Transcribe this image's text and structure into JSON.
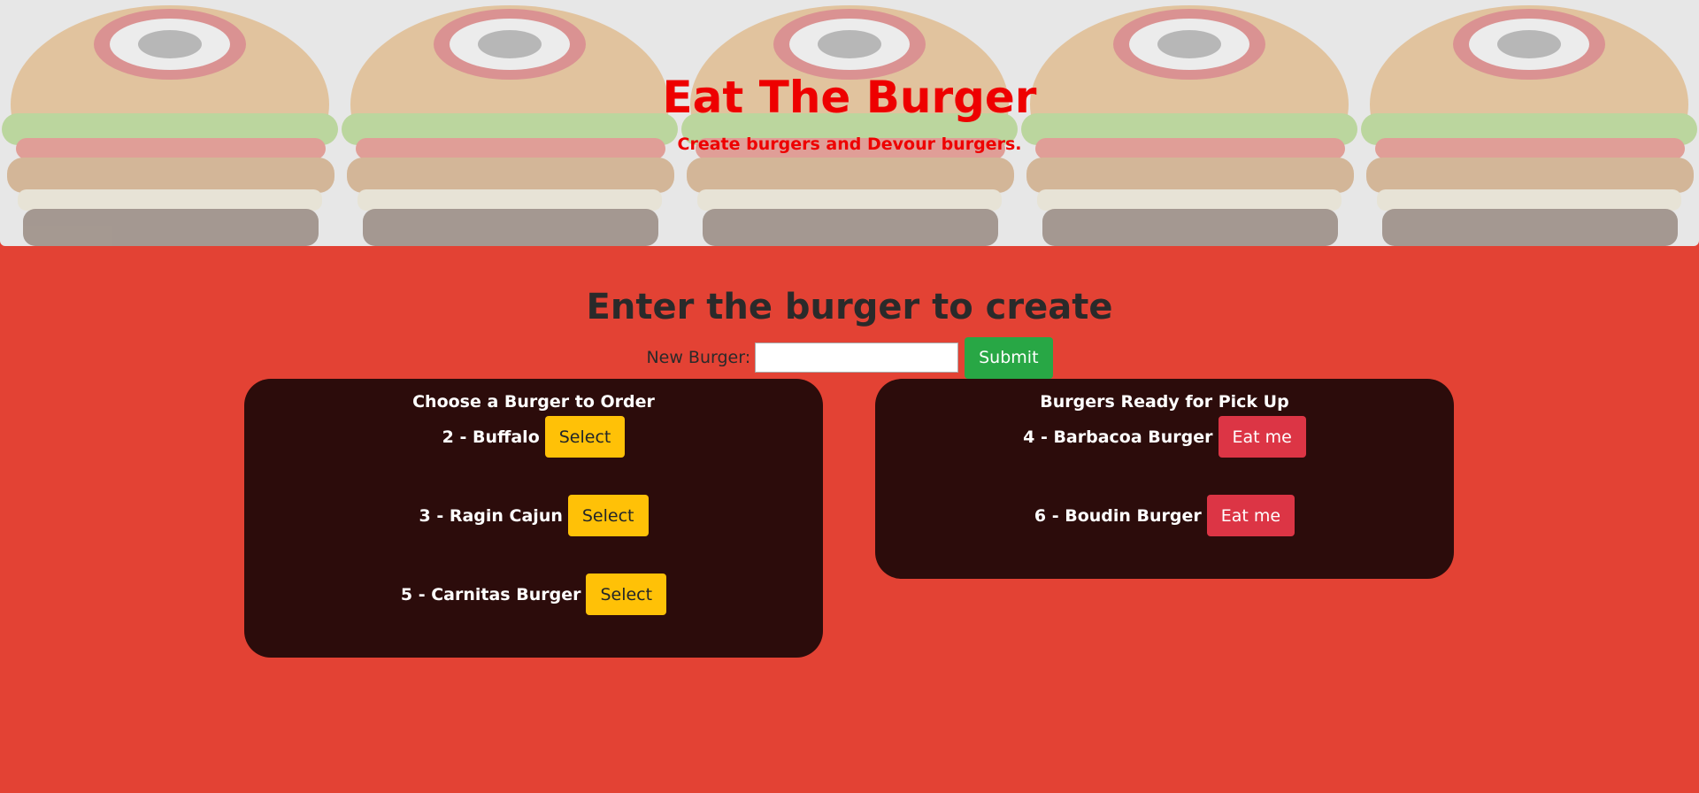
{
  "header": {
    "title": "Eat The Burger",
    "subtitle": "Create burgers and Devour burgers."
  },
  "create": {
    "title": "Enter the burger to create",
    "label": "New Burger:",
    "input_value": "",
    "submit_label": "Submit"
  },
  "order_panel": {
    "title": "Choose a Burger to Order",
    "items": [
      {
        "label": "2 - Buffalo",
        "button": "Select"
      },
      {
        "label": "3 - Ragin Cajun",
        "button": "Select"
      },
      {
        "label": "5 - Carnitas Burger",
        "button": "Select"
      }
    ]
  },
  "pickup_panel": {
    "title": "Burgers Ready for Pick Up",
    "items": [
      {
        "label": "4 - Barbacoa Burger",
        "button": "Eat me"
      },
      {
        "label": "6 - Boudin Burger",
        "button": "Eat me"
      }
    ]
  },
  "colors": {
    "page_background": "#e34234",
    "title_red": "#ee0000",
    "panel_background": "#2c0c0b",
    "submit_green": "#28a745",
    "select_yellow": "#ffc107",
    "eat_red": "#dc3545"
  },
  "icons": {
    "jumbotron_background": "burger-logo-pattern"
  }
}
